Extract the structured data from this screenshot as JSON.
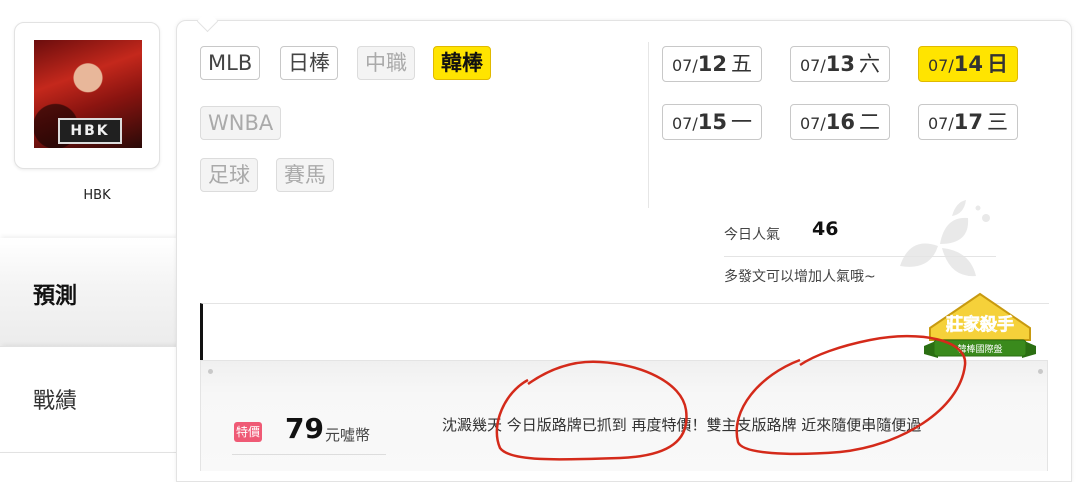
{
  "user": {
    "avatar_logo_text": "HBK",
    "name": "HBK"
  },
  "sidebar": {
    "tabs": [
      {
        "label": "預測",
        "active": true
      },
      {
        "label": "戰績",
        "active": false
      }
    ]
  },
  "sports": [
    {
      "label": "MLB",
      "state": "normal"
    },
    {
      "label": "日棒",
      "state": "normal"
    },
    {
      "label": "中職",
      "state": "disabled"
    },
    {
      "label": "韓棒",
      "state": "active"
    },
    {
      "label": "WNBA",
      "state": "disabled"
    },
    {
      "label": "足球",
      "state": "disabled"
    },
    {
      "label": "賽馬",
      "state": "disabled"
    }
  ],
  "dates": [
    {
      "month": "07/",
      "day": "12",
      "weekday": "五",
      "active": false
    },
    {
      "month": "07/",
      "day": "13",
      "weekday": "六",
      "active": false
    },
    {
      "month": "07/",
      "day": "14",
      "weekday": "日",
      "active": true
    },
    {
      "month": "07/",
      "day": "15",
      "weekday": "一",
      "active": false
    },
    {
      "month": "07/",
      "day": "16",
      "weekday": "二",
      "active": false
    },
    {
      "month": "07/",
      "day": "17",
      "weekday": "三",
      "active": false
    }
  ],
  "popularity": {
    "label": "今日人氣",
    "value": "46",
    "tip": "多發文可以增加人氣哦~"
  },
  "badge": {
    "title": "莊家殺手",
    "subtitle": "韓棒國際盤"
  },
  "listing": {
    "tag": "特價",
    "price": "79",
    "unit": "元噓幣",
    "description": "沈澱幾天 今日版路牌已抓到 再度特價！雙主支版路牌 近來隨便串隨便過"
  },
  "colors": {
    "active_yellow": "#ffe400",
    "tag_pink": "#ef5a75",
    "annotation_red": "#d42a1a",
    "badge_green": "#3a8a1c"
  }
}
